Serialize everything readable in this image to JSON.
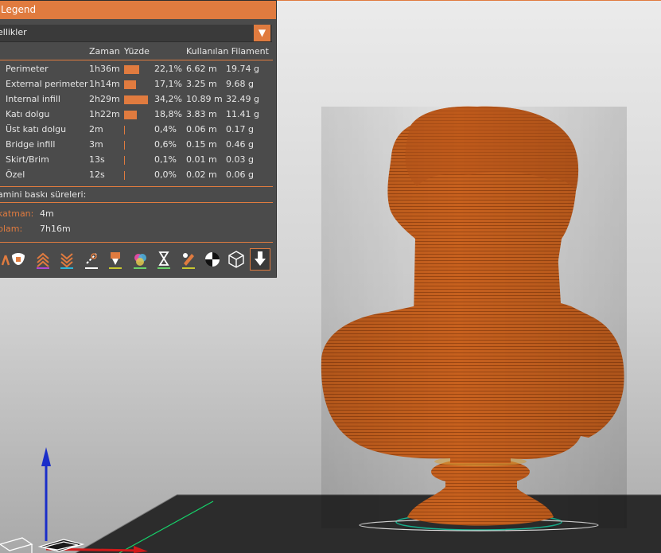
{
  "legend": {
    "title": "Legend",
    "view_type": "ellikler",
    "columns": {
      "time": "Zaman",
      "percent": "Yüzde",
      "used_filament": "Kullanılan Filament"
    },
    "rows": [
      {
        "name": "Perimeter",
        "time": "1h36m",
        "percent": "22,1%",
        "length": "6.62 m",
        "weight": "19.74 g",
        "share": 0.221
      },
      {
        "name": "External perimeter",
        "time": "1h14m",
        "percent": "17,1%",
        "length": "3.25 m",
        "weight": "9.68 g",
        "share": 0.171
      },
      {
        "name": "Internal infill",
        "time": "2h29m",
        "percent": "34,2%",
        "length": "10.89 m",
        "weight": "32.49 g",
        "share": 0.342
      },
      {
        "name": "Katı dolgu",
        "time": "1h22m",
        "percent": "18,8%",
        "length": "3.83 m",
        "weight": "11.41 g",
        "share": 0.188
      },
      {
        "name": "Üst katı dolgu",
        "time": "2m",
        "percent": "0,4%",
        "length": "0.06 m",
        "weight": "0.17 g",
        "share": 0.004
      },
      {
        "name": "Bridge infill",
        "time": "3m",
        "percent": "0,6%",
        "length": "0.15 m",
        "weight": "0.46 g",
        "share": 0.006
      },
      {
        "name": "Skirt/Brim",
        "time": "13s",
        "percent": "0,1%",
        "length": "0.01 m",
        "weight": "0.03 g",
        "share": 0.001
      },
      {
        "name": "Özel",
        "time": "12s",
        "percent": "0,0%",
        "length": "0.02 m",
        "weight": "0.06 g",
        "share": 0.0
      }
    ],
    "estimated_label": "amini baskı süreleri:",
    "first_layer_key": "katman:",
    "first_layer_value": "4m",
    "total_key": "plam:",
    "total_value": "7h16m",
    "toolbar_icons": [
      "travel-icon",
      "wipe-icon",
      "retractions-icon",
      "deretractions-icon",
      "seams-icon",
      "tool-changes-icon",
      "color-changes-icon",
      "pause-prints-icon",
      "custom-gcode-icon",
      "center-of-gravity-icon",
      "shells-icon",
      "tool-marker-icon"
    ]
  },
  "colors": {
    "accent": "#e07b3f",
    "panel_bg": "#4b4b4b",
    "model": "#c8611e",
    "bed": "#2c2c2c"
  }
}
